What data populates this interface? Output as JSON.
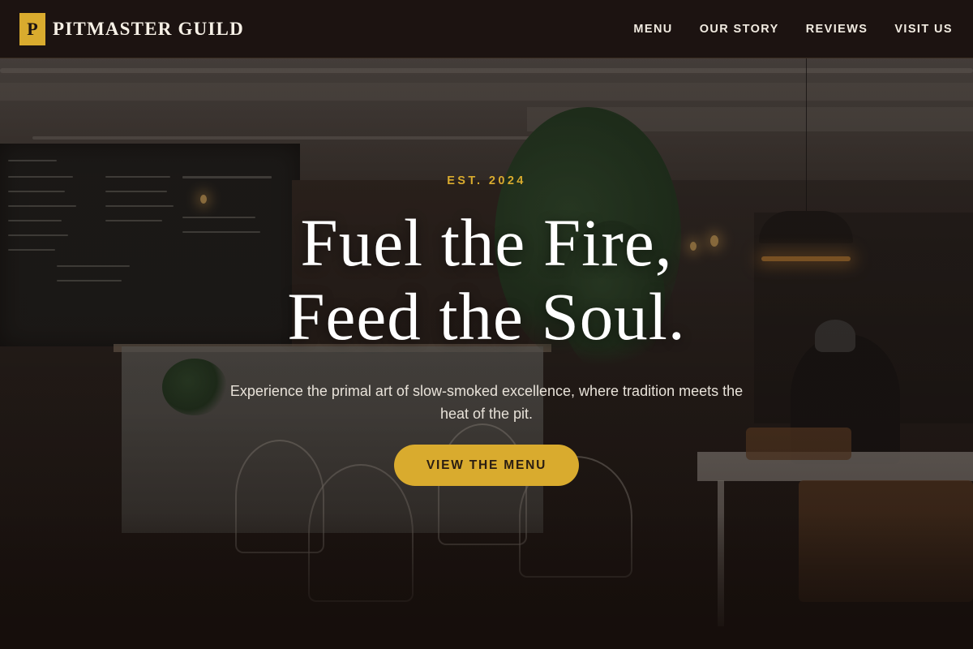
{
  "header": {
    "logo_letter": "P",
    "brand_name": "PITMASTER GUILD",
    "nav": [
      {
        "label": "MENU"
      },
      {
        "label": "OUR STORY"
      },
      {
        "label": "REVIEWS"
      },
      {
        "label": "VISIT US"
      }
    ]
  },
  "hero": {
    "eyebrow": "EST. 2024",
    "headline_line1": "Fuel the Fire,",
    "headline_line2": "Feed the Soul.",
    "subtext": "Experience the primal art of slow-smoked excellence, where tradition meets the heat of the pit.",
    "cta_label": "VIEW THE MENU"
  },
  "colors": {
    "accent": "#d9ab2e",
    "header_bg": "#1c1311",
    "text_light": "#ffffff"
  }
}
